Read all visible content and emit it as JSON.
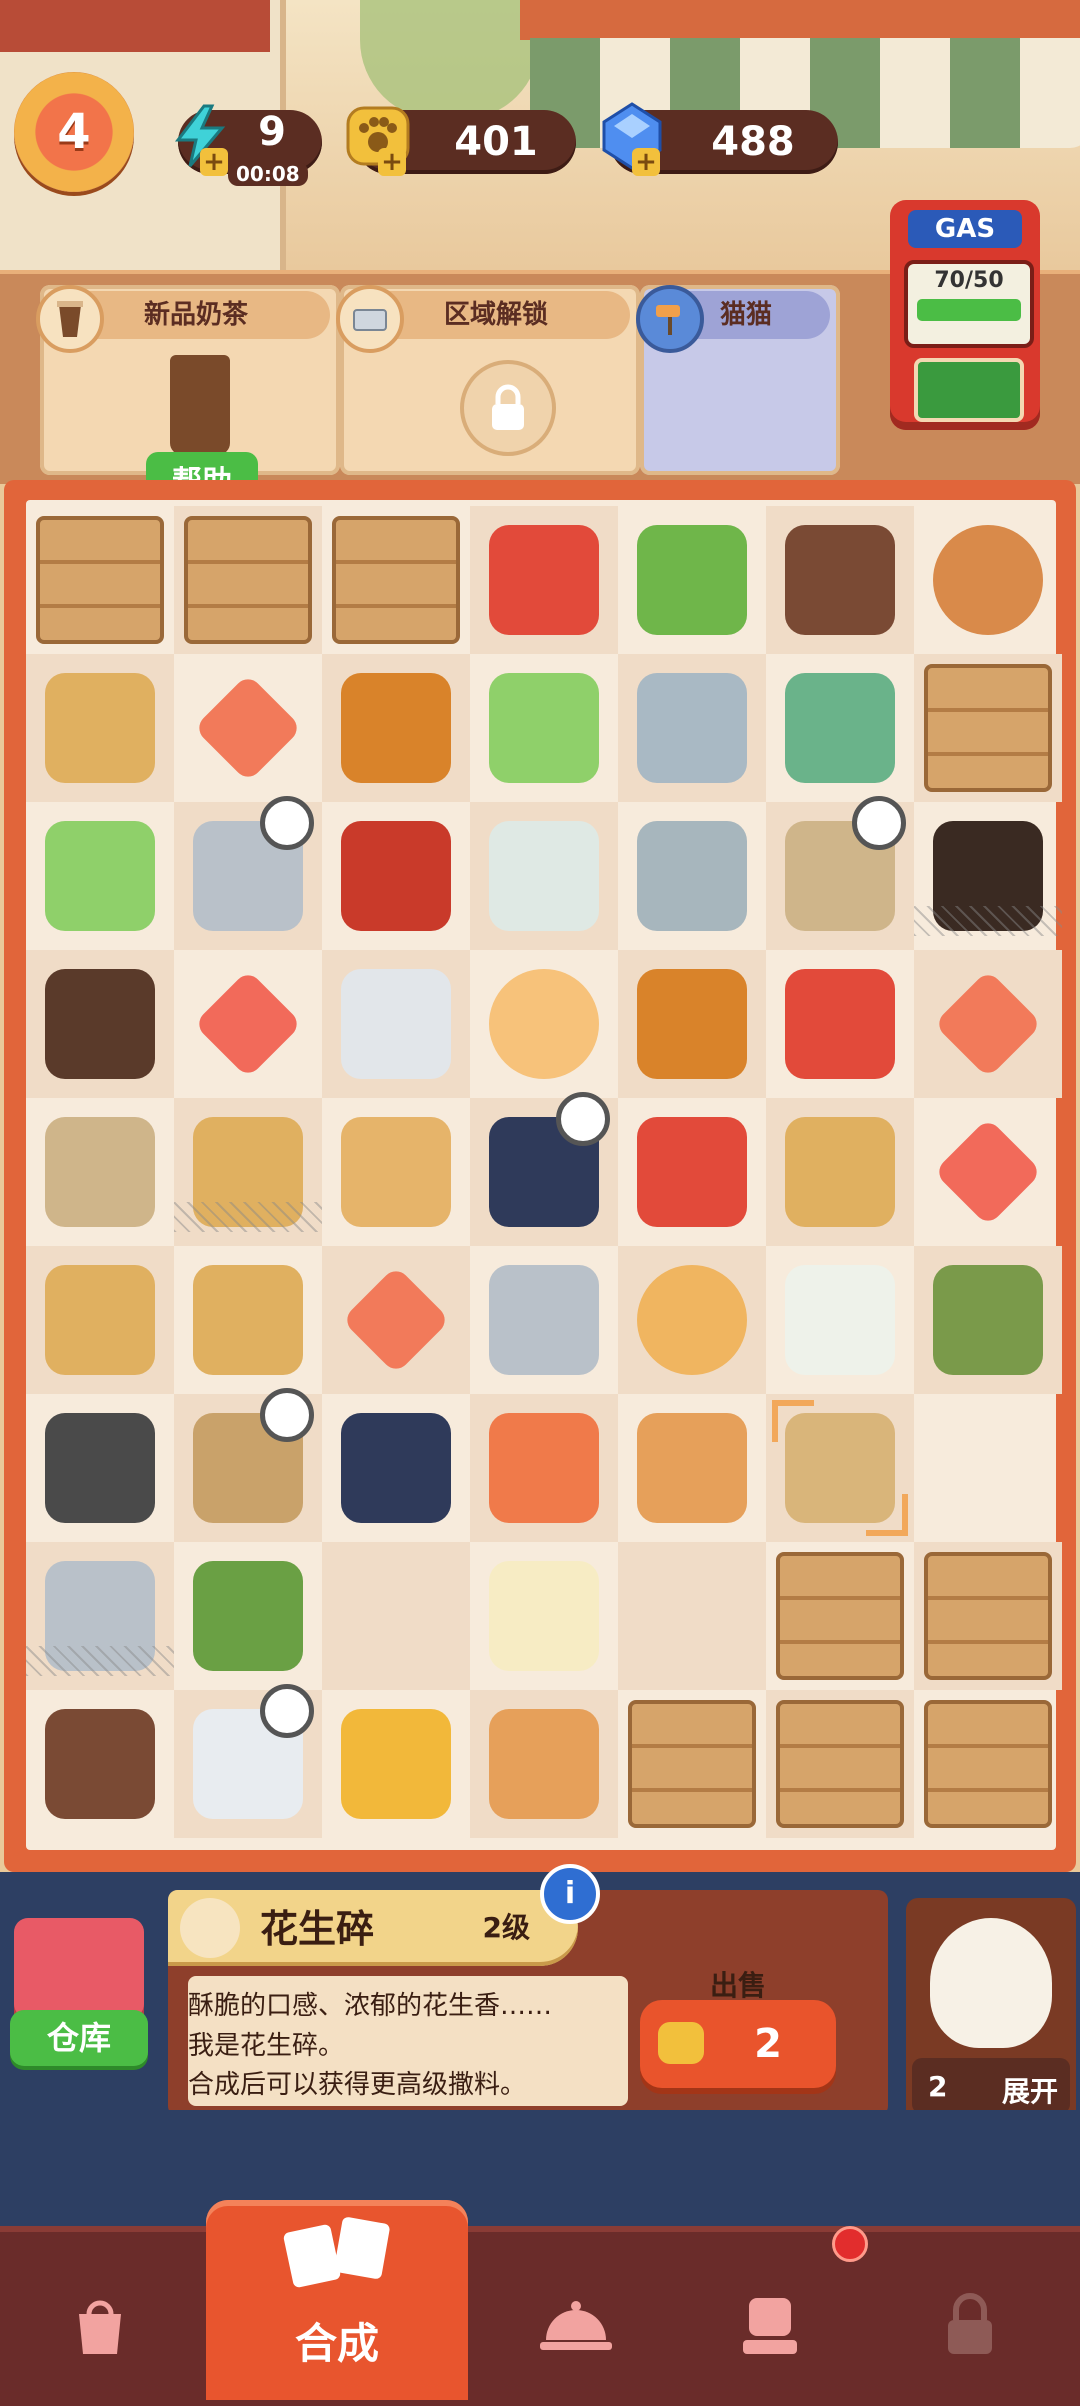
{
  "hud": {
    "level": "4",
    "energy": "9",
    "energy_timer": "00:08",
    "paws": "401",
    "gems": "488"
  },
  "tabs": [
    {
      "label": "新品奶茶",
      "icon": "milk-tea-icon"
    },
    {
      "label": "区域解锁",
      "icon": "tray-icon"
    },
    {
      "label": "猫猫",
      "icon": "roller-icon"
    }
  ],
  "help_label": "帮助",
  "gas_pump": {
    "title": "GAS",
    "value": "70/50"
  },
  "item": {
    "name": "花生碎",
    "level": "2级",
    "desc_line1": "酥脆的口感、浓郁的花生香……",
    "desc_line2": "我是花生碎。",
    "desc_line3": "合成后可以获得更高级撒料。",
    "sell_label": "出售",
    "sell_price": "2"
  },
  "warehouse_label": "仓库",
  "cat_panel": {
    "count": "2",
    "expand_label": "展开"
  },
  "nav": {
    "tabs": [
      "shop-bag-icon",
      "merge",
      "cloche-icon",
      "character-icon",
      "lock-icon"
    ],
    "active_label": "合成"
  },
  "grid": [
    [
      "crate",
      "crate",
      "crate",
      "ketchup",
      "beans",
      "mushroom",
      "meatball"
    ],
    [
      "bag",
      "gem",
      "sauce-bottle",
      "cabbage",
      "hotpot",
      "rice-cooker",
      "crate"
    ],
    [
      "cabbage",
      "safe",
      "chili-jar",
      "glue",
      "teapot",
      "rack",
      "coffee-cup"
    ],
    [
      "oil-bottle",
      "star",
      "printer-tray",
      "egg",
      "sauce-bottle",
      "ketchup",
      "triangle"
    ],
    [
      "rack",
      "bag",
      "toast",
      "ink",
      "ketchup",
      "bag",
      "star"
    ],
    [
      "box",
      "box",
      "gem",
      "bowl",
      "bun",
      "calendar",
      "herbs"
    ],
    [
      "tires",
      "cart",
      "ink",
      "skewers",
      "small-bottle",
      "peanuts",
      "empty"
    ],
    [
      "safe",
      "bonsai",
      "empty",
      "tofu",
      "empty",
      "crate",
      "crate"
    ],
    [
      "mushroom",
      "printer",
      "gold",
      "small-bottle",
      "crate",
      "crate",
      "crate"
    ]
  ],
  "colors": {
    "accent": "#e1653a",
    "board_bg": "#f7ebdc",
    "nav_active": "#e8552e",
    "green_button": "#4bbd45"
  }
}
